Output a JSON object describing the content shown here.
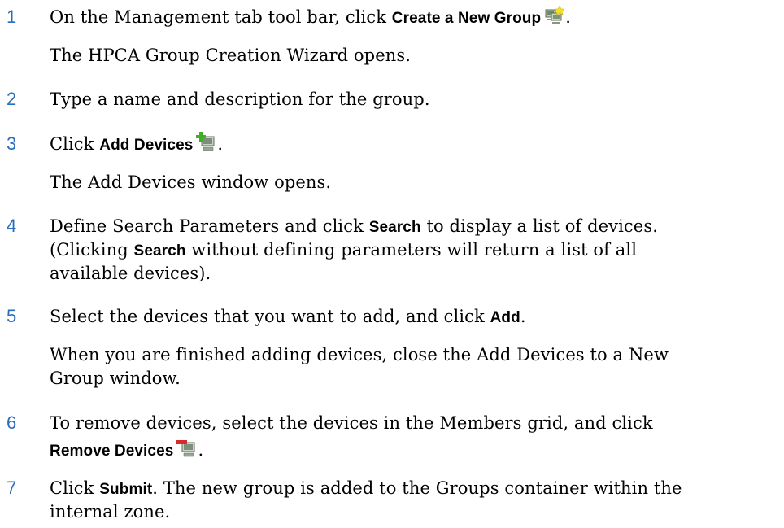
{
  "steps": [
    {
      "number": "1",
      "text_before": "On the Management tab tool bar, click ",
      "bold": "Create a New Group",
      "text_after": ".",
      "icon": "create-group-icon",
      "note": "The HPCA Group Creation Wizard opens."
    },
    {
      "number": "2",
      "text": "Type a name and description for the group."
    },
    {
      "number": "3",
      "text_before": "Click ",
      "bold": "Add Devices",
      "text_after": ".",
      "icon": "add-devices-icon",
      "note": "The Add Devices window opens."
    },
    {
      "number": "4",
      "line1_before": "Define Search Parameters and click ",
      "line1_bold": "Search",
      "line1_after": " to display a list of devices.",
      "line2_before": "(Clicking ",
      "line2_bold": "Search",
      "line2_after": " without defining parameters will return a list of all",
      "line3": "available devices)."
    },
    {
      "number": "5",
      "text_before": "Select the devices that you want to add, and click ",
      "bold": "Add",
      "text_after": ".",
      "note_line1": "When you are finished adding devices, close the Add Devices to a New",
      "note_line2": "Group window."
    },
    {
      "number": "6",
      "line1": "To remove devices, select the devices in the Members grid, and click",
      "bold": "Remove Devices",
      "text_after": ".",
      "icon": "remove-devices-icon"
    },
    {
      "number": "7",
      "text_before": "Click ",
      "bold": "Submit",
      "text_after": ". The new group is added to the Groups container within the",
      "line2": "internal zone."
    }
  ],
  "colors": {
    "step_number": "#2a6ebb",
    "body_text": "#000000"
  }
}
